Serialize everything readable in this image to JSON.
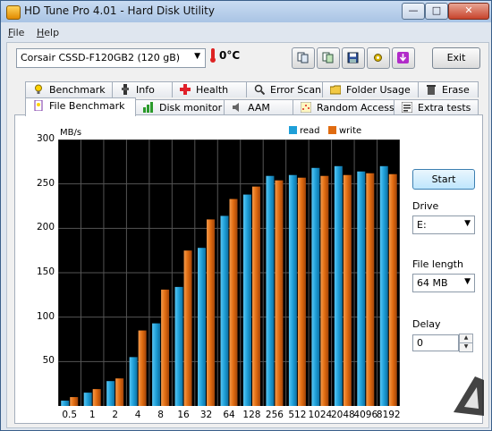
{
  "window": {
    "title": "HD Tune Pro 4.01 - Hard Disk Utility",
    "min_glyph": "—",
    "max_glyph": "□",
    "close_glyph": "✕"
  },
  "menu": {
    "file": {
      "ul": "F",
      "rest": "ile"
    },
    "help": {
      "ul": "H",
      "rest": "elp"
    }
  },
  "toolbar": {
    "drive": "Corsair CSSD-F120GB2   (120 gB)",
    "temperature": "0°C",
    "exit_label": "Exit"
  },
  "tabs_top": [
    {
      "label": "Benchmark",
      "icon": "bulb-icon"
    },
    {
      "label": "Info",
      "icon": "info-icon"
    },
    {
      "label": "Health",
      "icon": "health-cross-icon"
    },
    {
      "label": "Error Scan",
      "icon": "magnifier-icon"
    },
    {
      "label": "Folder Usage",
      "icon": "folder-icon"
    },
    {
      "label": "Erase",
      "icon": "trash-icon"
    }
  ],
  "tabs_bottom": [
    {
      "label": "File Benchmark",
      "icon": "file-icon",
      "active": true
    },
    {
      "label": "Disk monitor",
      "icon": "monitor-icon"
    },
    {
      "label": "AAM",
      "icon": "speaker-icon"
    },
    {
      "label": "Random Access",
      "icon": "random-icon"
    },
    {
      "label": "Extra tests",
      "icon": "extra-icon"
    }
  ],
  "controls": {
    "start_label": "Start",
    "drive_label": "Drive",
    "drive_value": "E:",
    "file_length_label": "File length",
    "file_length_value": "64 MB",
    "delay_label": "Delay",
    "delay_value": "0"
  },
  "chart_data": {
    "type": "bar",
    "ylabel": "MB/s",
    "ylim": [
      0,
      300
    ],
    "yticks": [
      50,
      100,
      150,
      200,
      250,
      300
    ],
    "categories": [
      "0.5",
      "1",
      "2",
      "4",
      "8",
      "16",
      "32",
      "64",
      "128",
      "256",
      "512",
      "1024",
      "2048",
      "4096",
      "8192"
    ],
    "series": [
      {
        "name": "read",
        "color": "#1e9fd8",
        "values": [
          6,
          15,
          28,
          55,
          93,
          134,
          178,
          214,
          238,
          259,
          260,
          268,
          270,
          264,
          270
        ]
      },
      {
        "name": "write",
        "color": "#e06b10",
        "values": [
          10,
          19,
          31,
          85,
          131,
          175,
          210,
          233,
          247,
          254,
          257,
          259,
          260,
          262,
          261
        ]
      }
    ],
    "grid": true,
    "legend": "top-right"
  },
  "colors": {
    "chart_bg": "#000000",
    "grid": "#555555"
  }
}
